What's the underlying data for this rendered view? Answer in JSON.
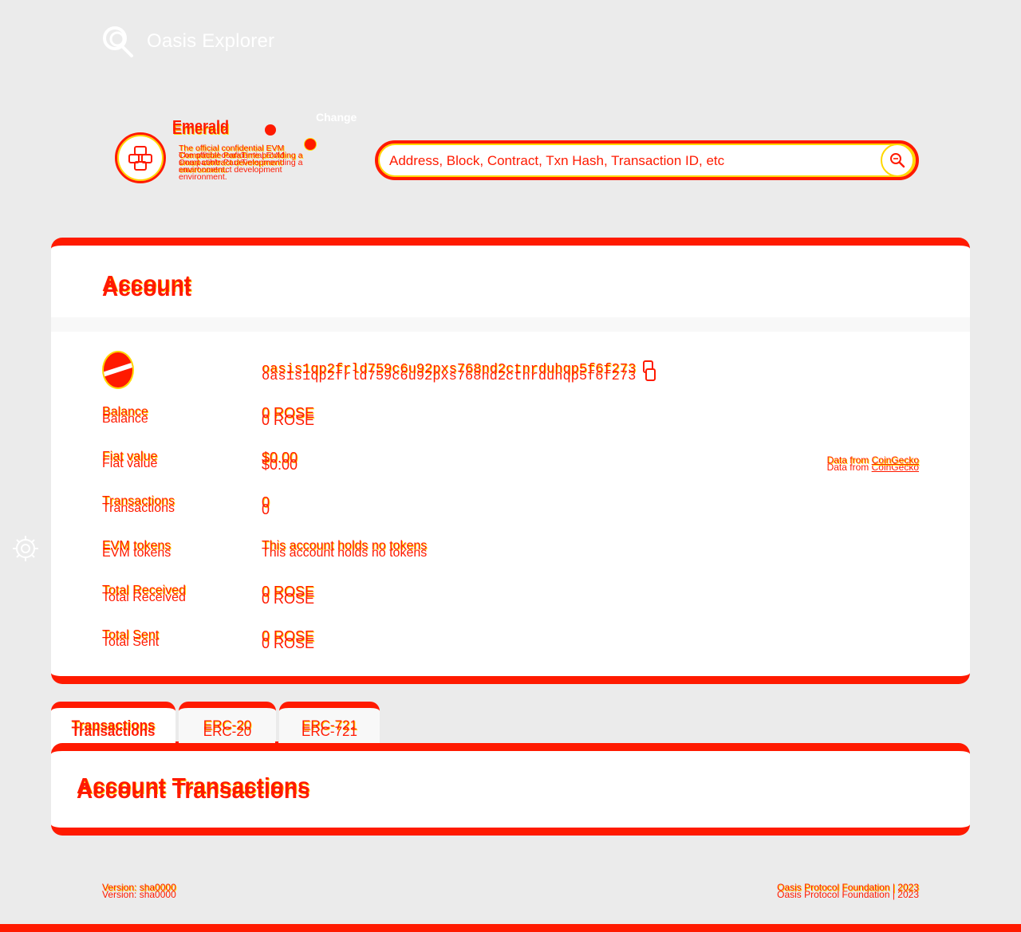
{
  "header": {
    "app_title": "Oasis Explorer"
  },
  "paratime": {
    "name": "Emerald",
    "description": "The official confidential EVM Compatible ParaTime providing a smart contract development environment.",
    "change_label": "Change"
  },
  "search": {
    "placeholder": "Address, Block, Contract, Txn Hash, Transaction ID, etc"
  },
  "account": {
    "title": "Account",
    "address": "oasis1qp2frld759c6u92pxs768nd2ctnrduhqp5f6f273",
    "rows": [
      {
        "label": "Balance",
        "value": "0 ROSE"
      },
      {
        "label": "Fiat value",
        "value": "$0.00"
      },
      {
        "label": "Transactions",
        "value": "0"
      },
      {
        "label": "EVM tokens",
        "value": "This account holds no tokens"
      },
      {
        "label": "Total Received",
        "value": "0 ROSE"
      },
      {
        "label": "Total Sent",
        "value": "0 ROSE"
      }
    ],
    "fiat_source_prefix": "Data from",
    "fiat_source_link": "CoinGecko"
  },
  "tabs": [
    {
      "label": "Transactions"
    },
    {
      "label": "ERC-20"
    },
    {
      "label": "ERC-721"
    }
  ],
  "transactions_card": {
    "title": "Account Transactions"
  },
  "footer": {
    "version": "Version: sha0000",
    "copyright": "Oasis Protocol Foundation | 2023"
  },
  "colors": {
    "accent": "#ff1a00",
    "highlight": "#ffd700",
    "background": "#ebebeb"
  }
}
